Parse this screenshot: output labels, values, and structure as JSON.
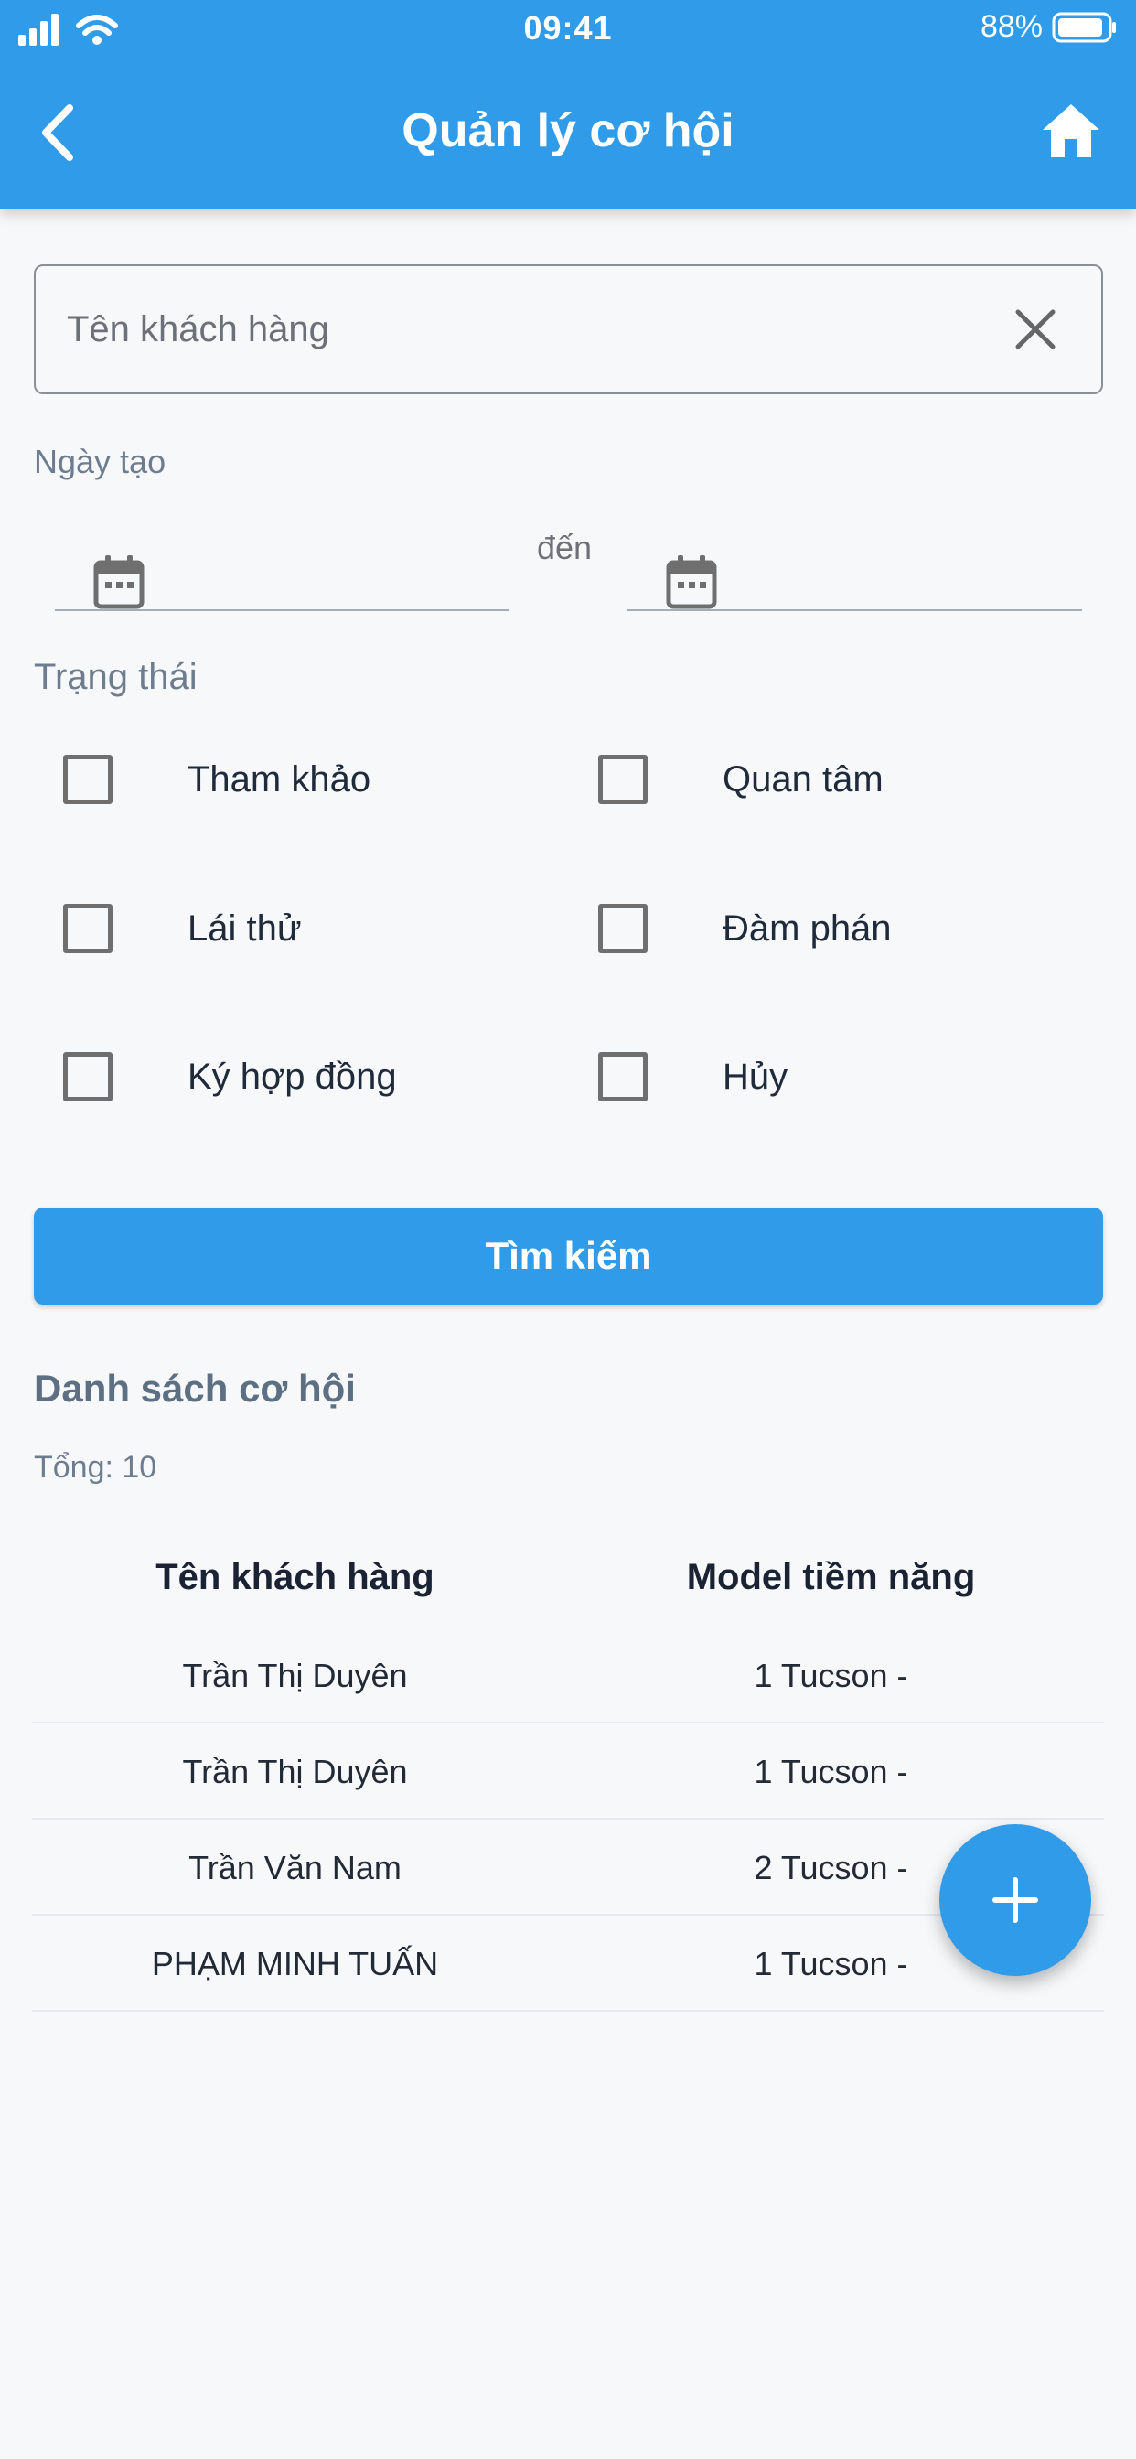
{
  "status_bar": {
    "time": "09:41",
    "battery": "88%"
  },
  "header": {
    "title": "Quản lý cơ hội"
  },
  "search": {
    "placeholder": "Tên khách hàng",
    "value": ""
  },
  "date_filter": {
    "label": "Ngày tạo",
    "to_label": "đến",
    "from_value": "",
    "to_value": ""
  },
  "status_filter": {
    "label": "Trạng thái",
    "options": [
      {
        "label": "Tham khảo",
        "checked": false
      },
      {
        "label": "Quan tâm",
        "checked": false
      },
      {
        "label": "Lái thử",
        "checked": false
      },
      {
        "label": "Đàm phán",
        "checked": false
      },
      {
        "label": "Ký hợp đồng",
        "checked": false
      },
      {
        "label": "Hủy",
        "checked": false
      }
    ]
  },
  "search_button": {
    "label": "Tìm kiếm"
  },
  "list": {
    "title": "Danh sách cơ hội",
    "total_label": "Tổng: 10",
    "columns": [
      "Tên khách hàng",
      "Model tiềm năng"
    ],
    "rows": [
      [
        "Trần Thị Duyên",
        "1 Tucson -"
      ],
      [
        "Trần Thị Duyên",
        "1 Tucson -"
      ],
      [
        "Trần Văn Nam",
        "2 Tucson -"
      ],
      [
        "PHẠM MINH TUẤN",
        "1 Tucson -"
      ]
    ]
  },
  "colors": {
    "primary": "#2f9be9",
    "background": "#f7f8fa",
    "muted_text": "#6d7d8f"
  },
  "icons": {
    "back": "chevron-left-icon",
    "home": "home-icon",
    "clear": "close-icon",
    "calendar": "calendar-icon",
    "add": "plus-icon"
  }
}
